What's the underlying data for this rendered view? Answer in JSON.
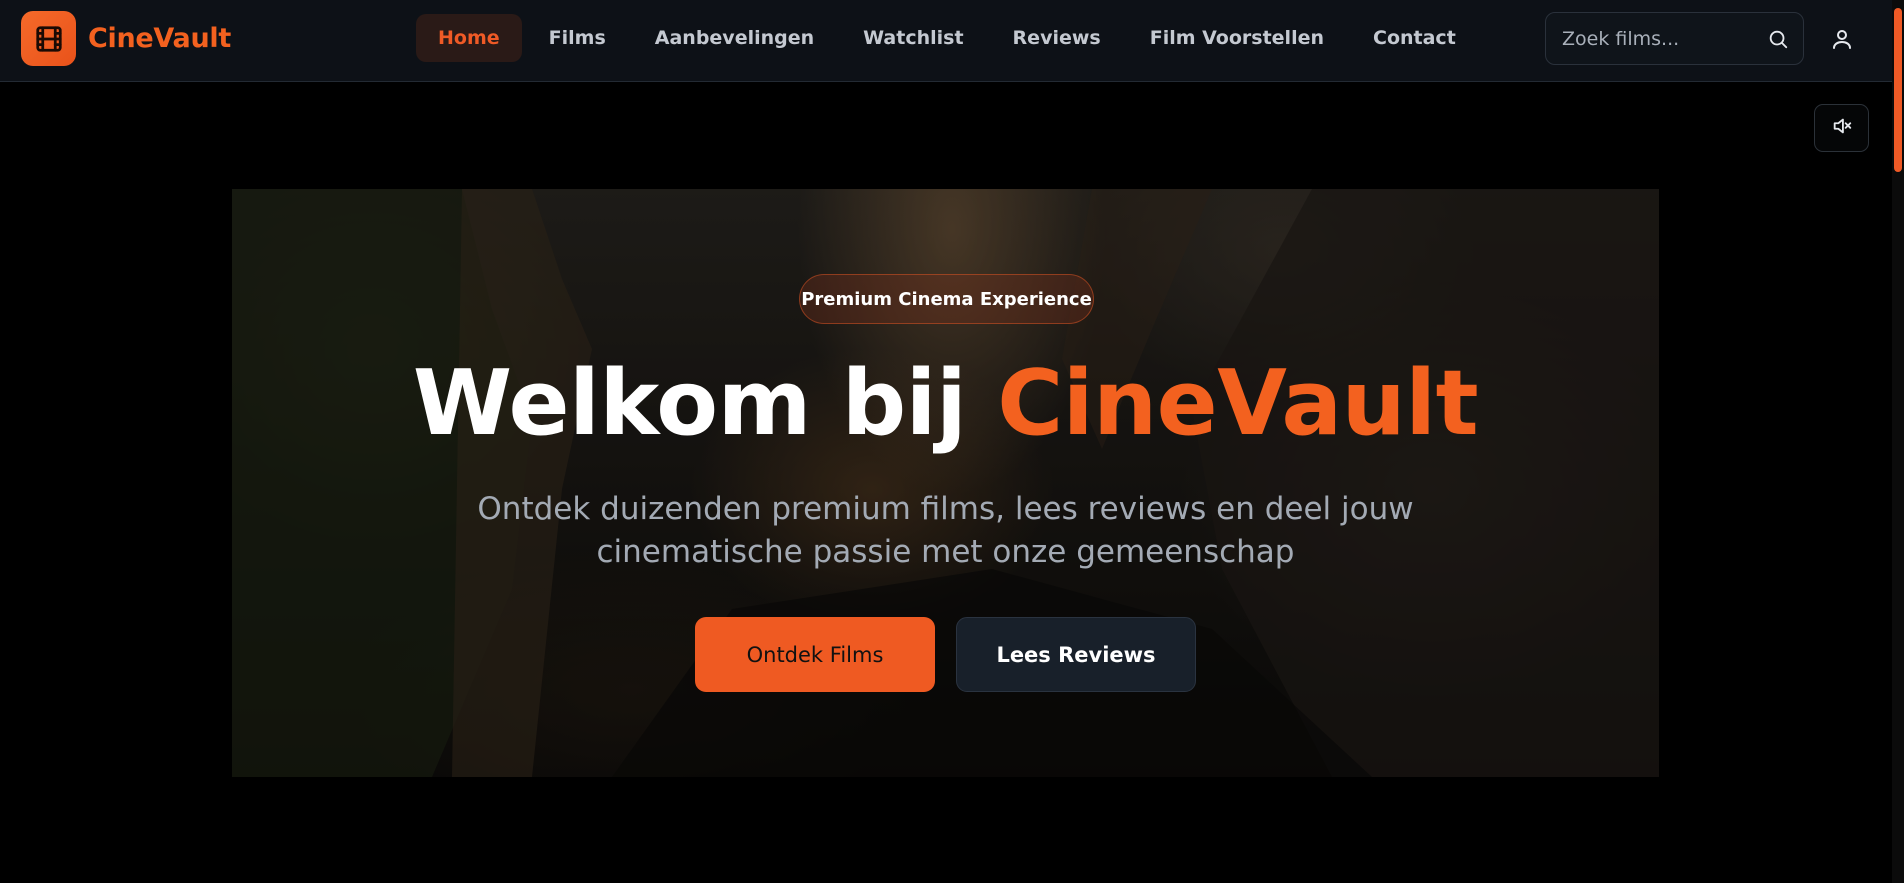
{
  "brand": {
    "name": "CineVault",
    "accent_color": "#f3611f",
    "icon": "film-icon"
  },
  "nav": {
    "items": [
      {
        "label": "Home",
        "active": true
      },
      {
        "label": "Films",
        "active": false
      },
      {
        "label": "Aanbevelingen",
        "active": false
      },
      {
        "label": "Watchlist",
        "active": false
      },
      {
        "label": "Reviews",
        "active": false
      },
      {
        "label": "Film Voorstellen",
        "active": false
      },
      {
        "label": "Contact",
        "active": false
      }
    ]
  },
  "search": {
    "placeholder": "Zoek films...",
    "value": "",
    "icon": "search-icon"
  },
  "user": {
    "icon": "user-icon"
  },
  "mute": {
    "icon": "volume-mute-icon"
  },
  "hero": {
    "badge": "Premium Cinema Experience",
    "headline_prefix": "Welkom bij",
    "headline_accent": "CineVault",
    "subtitle_line1": "Ontdek duizenden premium films, lees reviews en deel jouw",
    "subtitle_line2": "cinematische passie met onze gemeenschap",
    "primary_button": "Ontdek Films",
    "secondary_button": "Lees Reviews"
  }
}
